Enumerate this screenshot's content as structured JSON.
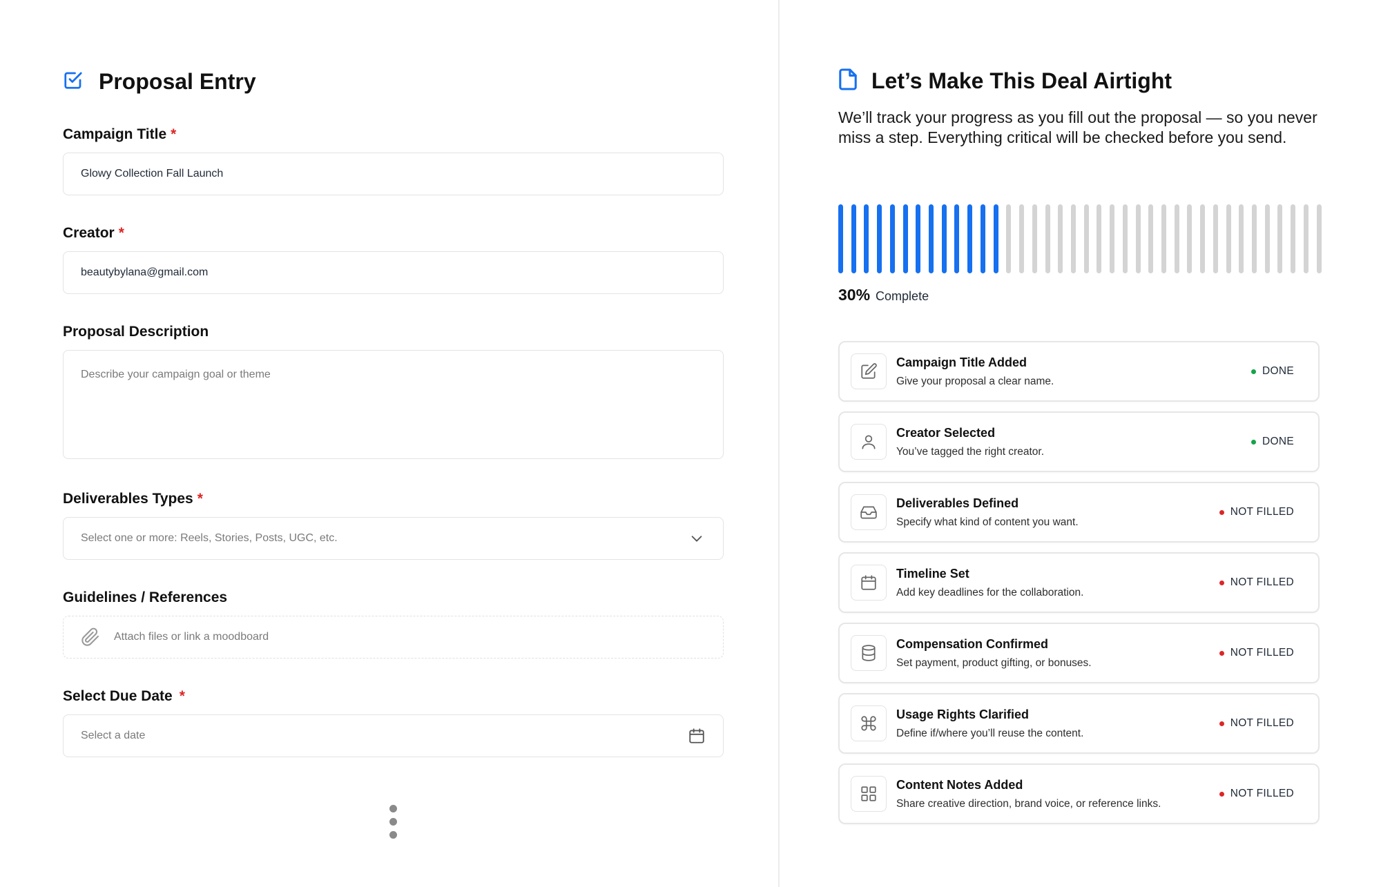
{
  "left": {
    "title": "Proposal Entry",
    "required_mark": "*",
    "campaign_title": {
      "label": "Campaign Title",
      "value": "Glowy Collection Fall Launch"
    },
    "creator": {
      "label": "Creator",
      "value": "beautybylana@gmail.com"
    },
    "description": {
      "label": "Proposal Description",
      "placeholder": "Describe your campaign goal or theme"
    },
    "deliverables": {
      "label": "Deliverables Types",
      "placeholder": "Select one or more: Reels, Stories, Posts, UGC, etc."
    },
    "guidelines": {
      "label": "Guidelines / References",
      "placeholder": "Attach files or link a moodboard"
    },
    "due_date": {
      "label": "Select Due Date",
      "placeholder": "Select a date"
    }
  },
  "right": {
    "title": "Let’s Make This Deal Airtight",
    "description": "We’ll track your progress as you fill out the proposal — so you never miss a step. Everything critical will be checked before you send.",
    "progress": {
      "percent_text": "30%",
      "label": "Complete",
      "filled_fraction": 0.3,
      "total_bars": 38,
      "filled_bars": 13
    },
    "checklist": [
      {
        "title": "Campaign Title Added",
        "desc": "Give your proposal a clear name.",
        "status": "DONE",
        "icon": "edit-icon"
      },
      {
        "title": "Creator Selected",
        "desc": "You’ve tagged the right creator.",
        "status": "DONE",
        "icon": "user-icon"
      },
      {
        "title": "Deliverables Defined",
        "desc": "Specify what kind of content you want.",
        "status": "NOT FILLED",
        "icon": "inbox-icon"
      },
      {
        "title": "Timeline Set",
        "desc": "Add key deadlines for the collaboration.",
        "status": "NOT FILLED",
        "icon": "calendar-icon"
      },
      {
        "title": "Compensation Confirmed",
        "desc": "Set payment, product gifting, or bonuses.",
        "status": "NOT FILLED",
        "icon": "database-icon"
      },
      {
        "title": "Usage Rights Clarified",
        "desc": "Define if/where you’ll reuse the content.",
        "status": "NOT FILLED",
        "icon": "command-icon"
      },
      {
        "title": "Content Notes Added",
        "desc": "Share creative direction, brand voice, or reference links.",
        "status": "NOT FILLED",
        "icon": "grid-icon"
      }
    ]
  },
  "colors": {
    "accent": "#1670f0",
    "done": "#16a34a",
    "not_filled": "#dc2626",
    "bar_empty": "#d4d4d4"
  }
}
